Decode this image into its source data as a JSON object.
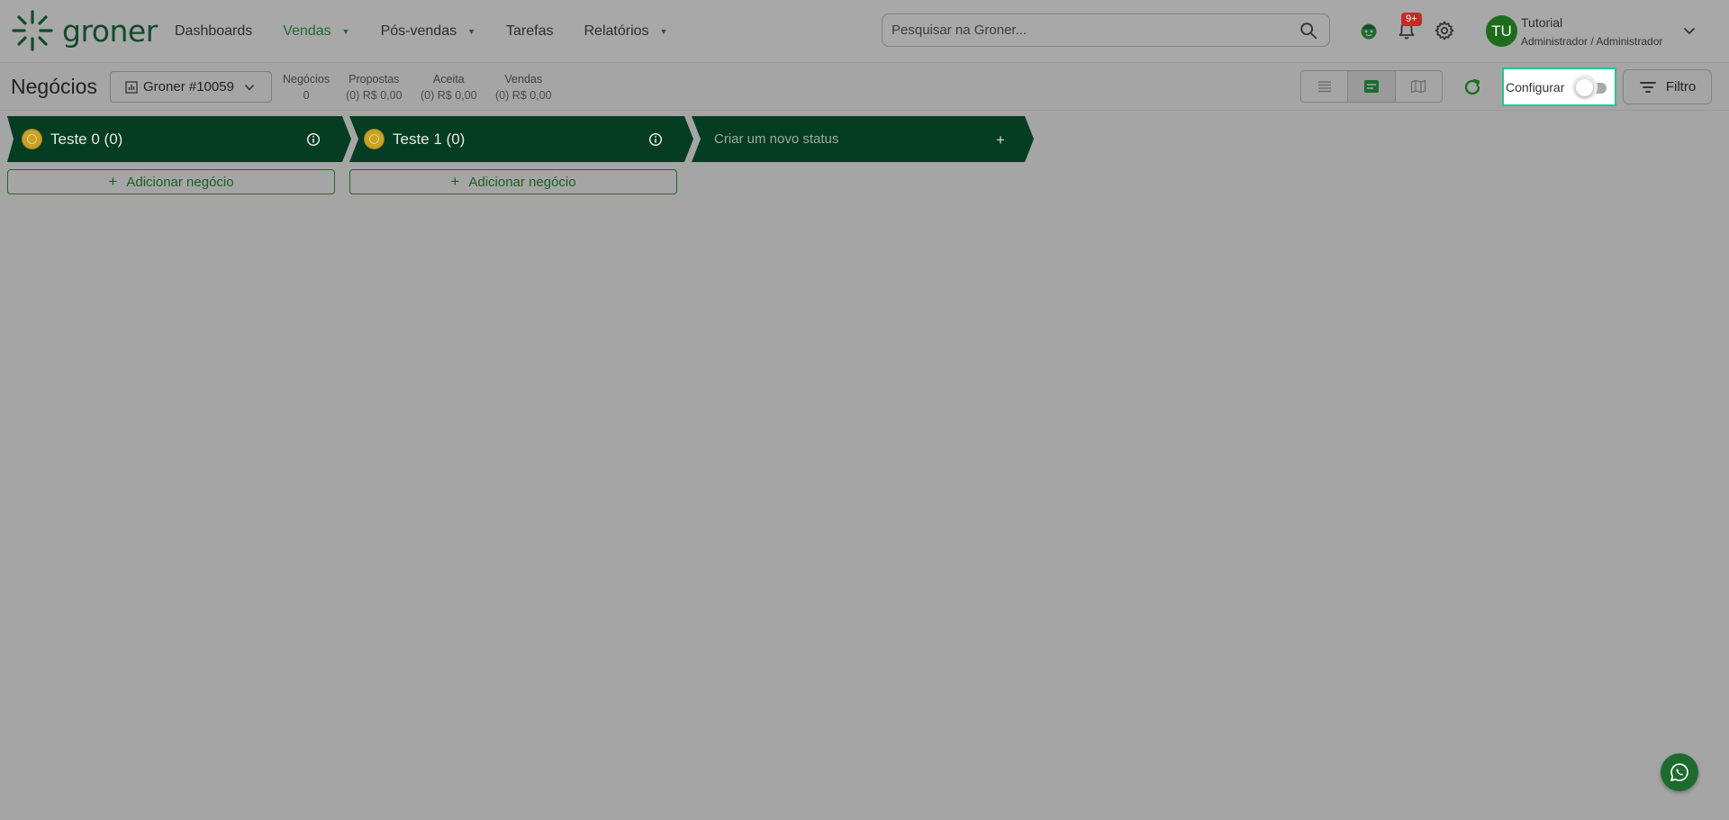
{
  "brand": {
    "name": "groner"
  },
  "nav": {
    "items": [
      {
        "label": "Dashboards",
        "dropdown": false
      },
      {
        "label": "Vendas",
        "dropdown": true,
        "active": true
      },
      {
        "label": "Pós-vendas",
        "dropdown": true
      },
      {
        "label": "Tarefas",
        "dropdown": false
      },
      {
        "label": "Relatórios",
        "dropdown": true
      }
    ]
  },
  "search": {
    "placeholder": "Pesquisar na Groner..."
  },
  "notifications": {
    "badge": "9+"
  },
  "user": {
    "initials": "TU",
    "name": "Tutorial",
    "role": "Administrador / Administrador"
  },
  "toolbar": {
    "title": "Negócios",
    "pipeline": "Groner #10059",
    "stats": [
      {
        "label": "Negócios",
        "value": "0"
      },
      {
        "label": "Propostas",
        "value": "(0) R$ 0,00"
      },
      {
        "label": "Aceita",
        "value": "(0) R$ 0,00"
      },
      {
        "label": "Vendas",
        "value": "(0) R$ 0,00"
      }
    ],
    "view_active": "kanban",
    "config_label": "Configurar",
    "config_on": false,
    "filter_label": "Filtro"
  },
  "kanban": {
    "columns": [
      {
        "title": "Teste 0 (0)",
        "add_label": "Adicionar negócio"
      },
      {
        "title": "Teste 1 (0)",
        "add_label": "Adicionar negócio"
      }
    ],
    "new_status_label": "Criar um novo status"
  },
  "colors": {
    "brand_green": "#1e6b33",
    "column_header": "#053d22",
    "highlight": "#20c997",
    "badge_red": "#c62828"
  }
}
